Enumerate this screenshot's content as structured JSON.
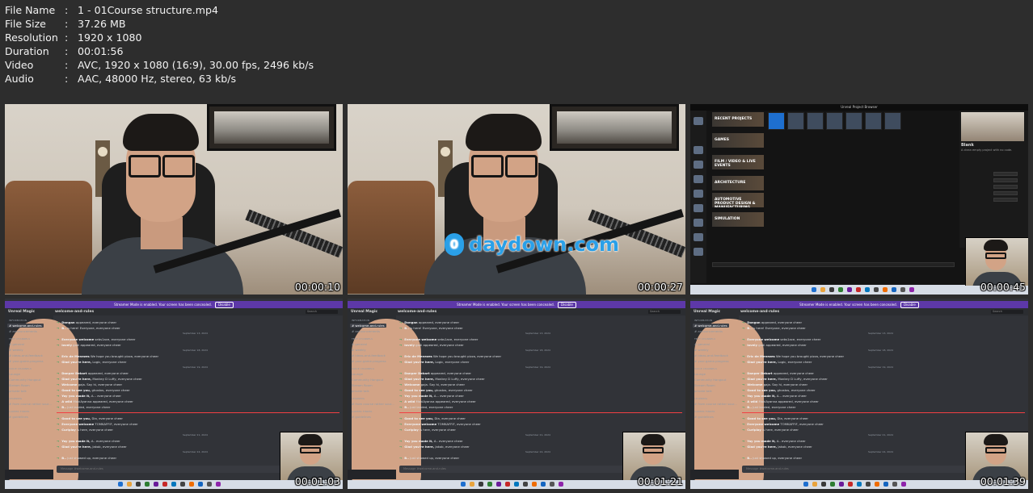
{
  "info": {
    "rows": [
      {
        "key": "File Name",
        "value": "1 - 01Course structure.mp4"
      },
      {
        "key": "File Size",
        "value": "37.26 MB"
      },
      {
        "key": "Resolution",
        "value": "1920 x 1080"
      },
      {
        "key": "Duration",
        "value": "00:01:56"
      },
      {
        "key": "Video",
        "value": "AVC, 1920 x 1080 (16:9), 30.00 fps, 2496 kb/s"
      },
      {
        "key": "Audio",
        "value": "AAC, 48000 Hz, stereo, 63 kb/s"
      }
    ],
    "separator": ":"
  },
  "thumbnails": [
    {
      "timestamp": "00:00:10",
      "scene": "webcam"
    },
    {
      "timestamp": "00:00:27",
      "scene": "webcam",
      "watermark": "daydown.com"
    },
    {
      "timestamp": "00:00:45",
      "scene": "unreal"
    },
    {
      "timestamp": "00:01:03",
      "scene": "discord"
    },
    {
      "timestamp": "00:01:21",
      "scene": "discord"
    },
    {
      "timestamp": "00:01:39",
      "scene": "discord"
    }
  ],
  "watermark_icon": "0",
  "unreal": {
    "window_title": "Unreal Project Browser",
    "categories": [
      "RECENT PROJECTS",
      "GAMES",
      "FILM / VIDEO & LIVE EVENTS",
      "ARCHITECTURE",
      "AUTOMOTIVE PRODUCT DESIGN & MANUFACTURING",
      "SIMULATION"
    ],
    "selected_template": "Blank",
    "template_desc": "A clean empty project with no code."
  },
  "discord": {
    "banner_text": "Streamer Mode is enabled. Your screen has been concealed.",
    "banner_button": "Disable",
    "server_name": "Unreal Magic",
    "channel_name": "welcome-and-rules",
    "search_placeholder": "Search",
    "channels": [
      {
        "label": "INFORMATION",
        "head": true
      },
      {
        "label": "# welcome-and-rules",
        "active": true
      },
      {
        "label": "# announcements"
      },
      {
        "label": "TEXT CHANNELS",
        "head": true
      },
      {
        "label": "# general"
      },
      {
        "label": "# weekly"
      },
      {
        "label": "# ideas-and-feedback"
      },
      {
        "label": "# your-game-progress"
      },
      {
        "label": "VOICE CHANNELS",
        "head": true
      },
      {
        "label": "Lounge"
      },
      {
        "label": "Community Hangout"
      },
      {
        "label": "Stream Room"
      },
      {
        "label": "private talk"
      },
      {
        "label": "LEARNING",
        "head": true
      },
      {
        "label": "# from course rather sour..."
      },
      {
        "label": "CAREER FINDER",
        "head": true
      },
      {
        "label": "# guidelines"
      }
    ],
    "messages": [
      {
        "name": "Dongan",
        "text": "appeared, everyone cheer"
      },
      {
        "name": "B..",
        "text": "is here! Everyone, everyone cheer"
      },
      {
        "date": "September 13, 2024"
      },
      {
        "name": "Everyone welcome",
        "text": "sebs1ace, everyone cheer"
      },
      {
        "name": "lovely",
        "text": "godi appeared, everyone cheer"
      },
      {
        "date": "September 18, 2024"
      },
      {
        "name": "Eric de Menezes",
        "text": "We hope you brought pizza, everyone cheer"
      },
      {
        "name": "Glad you're here,",
        "text": "Logic, everyone cheer"
      },
      {
        "date": "September 19, 2024"
      },
      {
        "name": "Danper Dekart",
        "text": "appeared, everyone cheer"
      },
      {
        "name": "Glad you're here,",
        "text": "Monkey D Luffy, everyone cheer"
      },
      {
        "name": "Welcome",
        "text": "gaja. Say hi, everyone cheer"
      },
      {
        "name": "Good to see you,",
        "text": "ghostos, everyone cheer"
      },
      {
        "name": "Yay you made it,",
        "text": "A... everyone cheer"
      },
      {
        "name": "A wild",
        "text": "MakiAyanna appeared, everyone cheer"
      },
      {
        "name": "B..",
        "text": "just landed, everyone cheer"
      },
      {
        "new": true
      },
      {
        "name": "Good to see you,",
        "text": "Dia, everyone cheer"
      },
      {
        "name": "Everyone welcome",
        "text": "TOMKAFFIF, everyone cheer"
      },
      {
        "name": "Curiplay",
        "text": "is here, everyone cheer"
      },
      {
        "date": "September 21, 2024"
      },
      {
        "name": "Yay you made it,",
        "text": "A.. everyone cheer"
      },
      {
        "name": "Glad you're here,",
        "text": "Jakob, everyone cheer"
      },
      {
        "date": "September 24, 2024"
      },
      {
        "name": "B..",
        "text": "just showed up, everyone cheer"
      }
    ],
    "input_placeholder": "Message #welcome-and-rules"
  },
  "colors": {
    "background": "#2d2d2d",
    "discord_banner": "#5d38a8",
    "accent_blue": "#2aa0e8"
  }
}
